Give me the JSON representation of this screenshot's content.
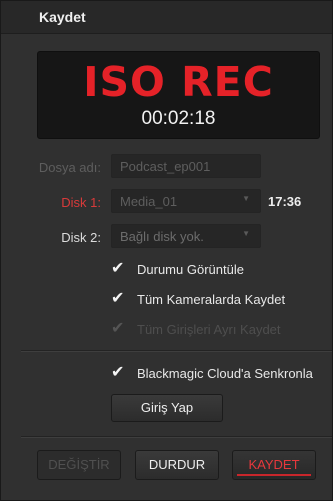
{
  "panel": {
    "title": "Kaydet"
  },
  "display": {
    "status": "ISO REC",
    "timecode": "00:02:18"
  },
  "file": {
    "label": "Dosya adı:",
    "value": "Podcast_ep001"
  },
  "disk1": {
    "label": "Disk 1:",
    "value": "Media_01",
    "remaining": "17:36"
  },
  "disk2": {
    "label": "Disk 2:",
    "value": "Bağlı disk yok."
  },
  "options": [
    {
      "label": "Durumu Görüntüle",
      "checked": true,
      "enabled": true
    },
    {
      "label": "Tüm Kameralarda Kaydet",
      "checked": true,
      "enabled": true
    },
    {
      "label": "Tüm Girişleri Ayrı Kaydet",
      "checked": true,
      "enabled": false
    }
  ],
  "cloud": {
    "label": "Blackmagic Cloud'a Senkronla",
    "checked": true,
    "login_label": "Giriş Yap"
  },
  "buttons": {
    "change": "DEĞİŞTİR",
    "stop": "DURDUR",
    "record": "KAYDET"
  },
  "colors": {
    "rec_red": "#e52228",
    "disk_label_red": "#d83a3a",
    "panel_bg": "#303030"
  },
  "icons": {
    "dropdown": "triangle-down",
    "check": "checkmark"
  }
}
